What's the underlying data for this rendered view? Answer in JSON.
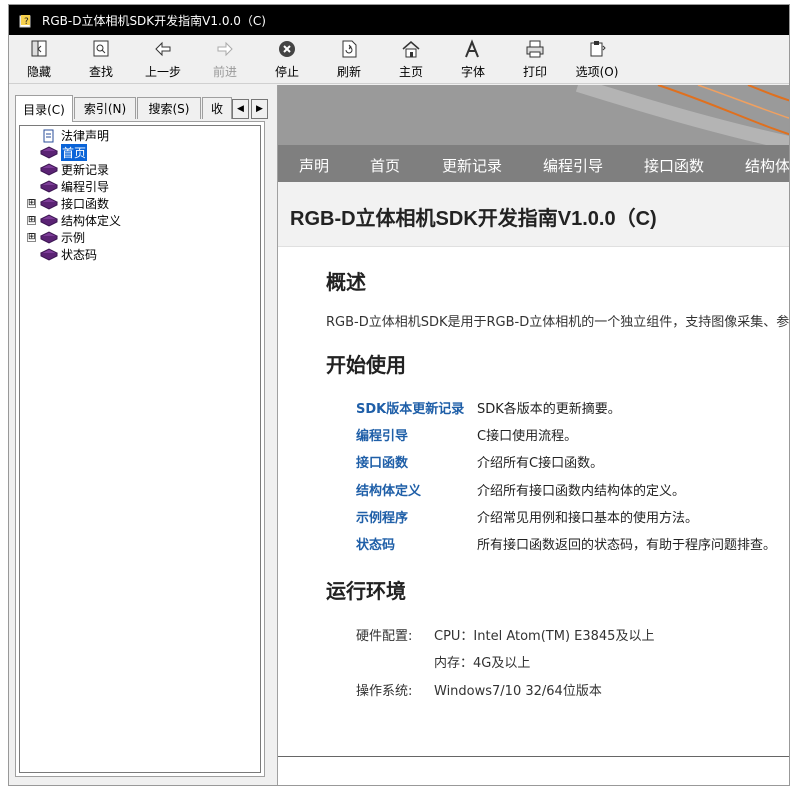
{
  "window": {
    "title": "RGB-D立体相机SDK开发指南V1.0.0（C)"
  },
  "toolbar": {
    "hide": "隐藏",
    "find": "查找",
    "back": "上一步",
    "forward": "前进",
    "stop": "停止",
    "refresh": "刷新",
    "home": "主页",
    "font": "字体",
    "print": "打印",
    "options": "选项(O)"
  },
  "tabs": {
    "contents": "目录(C)",
    "index": "索引(N)",
    "search": "搜索(S)",
    "favorites": "收"
  },
  "tree": {
    "legal": "法律声明",
    "home": "首页",
    "changelog": "更新记录",
    "guide": "编程引导",
    "api": "接口函数",
    "structs": "结构体定义",
    "examples": "示例",
    "status": "状态码",
    "expand_symbol": "⊞"
  },
  "nav": {
    "items": [
      "声明",
      "首页",
      "更新记录",
      "编程引导",
      "接口函数",
      "结构体定义"
    ]
  },
  "page": {
    "title": "RGB-D立体相机SDK开发指南V1.0.0（C)",
    "overview_heading": "概述",
    "overview_text": "RGB-D立体相机SDK是用于RGB-D立体相机的一个独立组件，支持图像采集、参数配置及设备管理等功能。",
    "start_heading": "开始使用",
    "links": [
      {
        "name": "SDK版本更新记录",
        "desc": "SDK各版本的更新摘要。"
      },
      {
        "name": "编程引导",
        "desc": "C接口使用流程。"
      },
      {
        "name": "接口函数",
        "desc": "介绍所有C接口函数。"
      },
      {
        "name": "结构体定义",
        "desc": "介绍所有接口函数内结构体的定义。"
      },
      {
        "name": "示例程序",
        "desc": "介绍常见用例和接口基本的使用方法。"
      },
      {
        "name": "状态码",
        "desc": "所有接口函数返回的状态码，有助于程序问题排查。"
      }
    ],
    "env_heading": "运行环境",
    "env": {
      "hw_label": "硬件配置:",
      "cpu": "CPU：Intel Atom(TM) E3845及以上",
      "mem": "内存：4G及以上",
      "os_label": "操作系统:",
      "os": "Windows7/10 32/64位版本"
    }
  },
  "colors": {
    "link": "#1f5fa8",
    "nav_bg": "#7f7f7f",
    "banner": "#9a9a9a",
    "selection": "#0a64d8"
  }
}
